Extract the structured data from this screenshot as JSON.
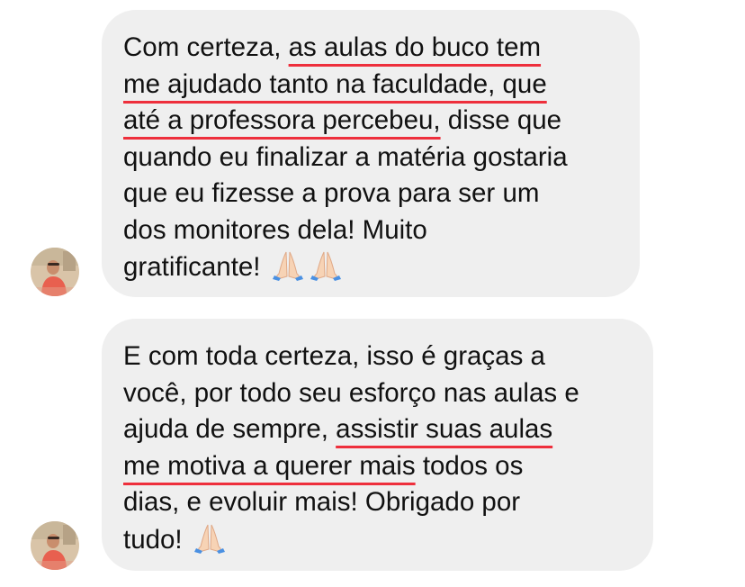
{
  "conversation": {
    "messages": [
      {
        "segments": [
          {
            "text": "Com certeza, ",
            "highlight": false
          },
          {
            "text": "as aulas do buco tem\nme ajudado tanto na faculdade, que\naté a professora percebeu,",
            "highlight": true
          },
          {
            "text": " disse que\nquando eu finalizar a matéria gostaria\nque eu fizesse a prova para ser um\ndos monitores dela! Muito\ngratificante! ",
            "highlight": false
          }
        ],
        "emoji": [
          "folded-hands-icon",
          "folded-hands-icon"
        ]
      },
      {
        "segments": [
          {
            "text": "E com toda certeza, isso é graças a\nvocê, por todo seu esforço nas aulas e\najuda de sempre, ",
            "highlight": false
          },
          {
            "text": "assistir suas aulas\nme motiva a querer mais",
            "highlight": true
          },
          {
            "text": " todos os\ndias, e evoluir mais! Obrigado por\ntudo! ",
            "highlight": false
          }
        ],
        "emoji": [
          "folded-hands-icon"
        ]
      }
    ]
  },
  "colors": {
    "bubble_background": "#efefef",
    "text": "#111111",
    "highlight_underline": "#ee2f3c"
  }
}
